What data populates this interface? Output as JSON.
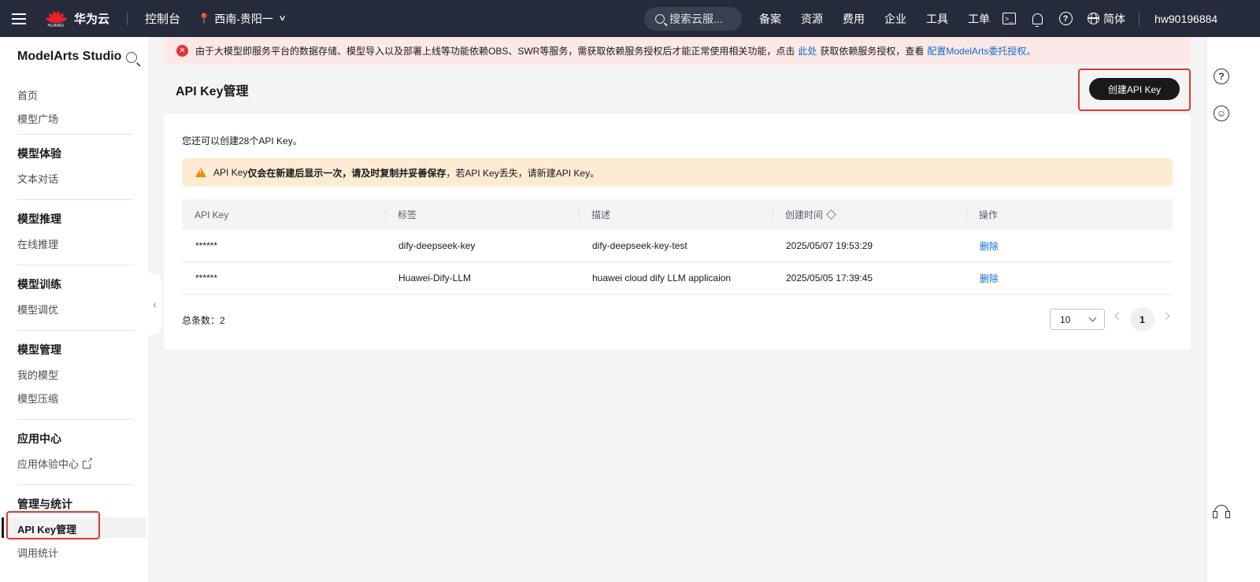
{
  "topbar": {
    "brand_wordmark": "HUAWEI",
    "brand": "华为云",
    "console": "控制台",
    "region": "西南-贵阳一",
    "search_placeholder": "搜索云服...",
    "links": [
      "备案",
      "资源",
      "费用",
      "企业",
      "工具",
      "工单"
    ],
    "icons": [
      "terminal-icon",
      "bell-icon",
      "help-icon"
    ],
    "language": "简体",
    "user": "hw90196884",
    "colors": {
      "bg": "#252b3a",
      "logo_red": "#e3222e"
    }
  },
  "sidebar": {
    "title": "ModelArts Studio",
    "items": [
      {
        "label": "首页"
      },
      {
        "label": "模型广场"
      }
    ],
    "sections": [
      {
        "heading": "模型体验",
        "items": [
          "文本对话"
        ]
      },
      {
        "heading": "模型推理",
        "items": [
          "在线推理"
        ]
      },
      {
        "heading": "模型训练",
        "items": [
          "模型调优"
        ]
      },
      {
        "heading": "模型管理",
        "items": [
          "我的模型",
          "模型压缩"
        ]
      },
      {
        "heading": "应用中心",
        "items": [
          "应用体验中心"
        ]
      },
      {
        "heading": "管理与统计",
        "items": [
          "API Key管理",
          "调用统计"
        ]
      }
    ],
    "active": "API Key管理"
  },
  "alert": {
    "text": "由于大模型即服务平台的数据存储、模型导入以及部署上线等功能依赖OBS、SWR等服务，需获取依赖服务授权后才能正常使用相关功能，点击",
    "link1": "此处",
    "text2": "获取依赖服务授权，查看",
    "link2": "配置ModelArts委托授权。",
    "color": "#fde8e8"
  },
  "page": {
    "title": "API Key管理",
    "create_button": "创建API Key",
    "remaining": "您还可以创建28个API Key。",
    "warning": {
      "prefix": "API Key",
      "bold": "仅会在新建后显示一次，请及时复制并妥善保存",
      "suffix": "，若API Key丢失，请新建API Key。"
    }
  },
  "table": {
    "columns": [
      "API Key",
      "标签",
      "描述",
      "创建时间",
      "操作"
    ],
    "rows": [
      {
        "key": "******",
        "tag": "dify-deepseek-key",
        "desc": "dify-deepseek-key-test",
        "created": "2025/05/07 19:53:29",
        "action": "删除"
      },
      {
        "key": "******",
        "tag": "Huawei-Dify-LLM",
        "desc": "huawei cloud dify LLM applicaion",
        "created": "2025/05/05 17:39:45",
        "action": "删除"
      }
    ]
  },
  "pagination": {
    "total": "总条数：2",
    "page_size": "10",
    "current_page": "1"
  },
  "colors": {
    "accent": "#191919",
    "link": "#0d6ccf",
    "highlight": "#e3382f",
    "warning_bg": "#feebd3"
  }
}
